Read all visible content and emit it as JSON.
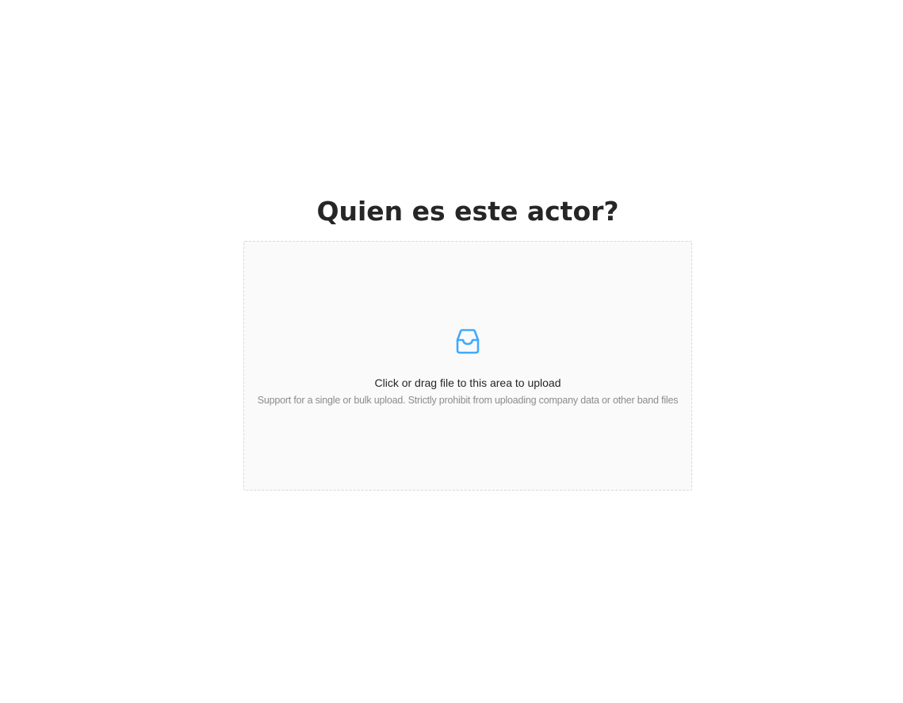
{
  "page": {
    "title": "Quien es este actor?"
  },
  "upload": {
    "icon": "inbox-icon",
    "accent_color": "#40a9ff",
    "main_text": "Click or drag file to this area to upload",
    "hint_text": "Support for a single or bulk upload. Strictly prohibit from uploading company data or other band files"
  }
}
